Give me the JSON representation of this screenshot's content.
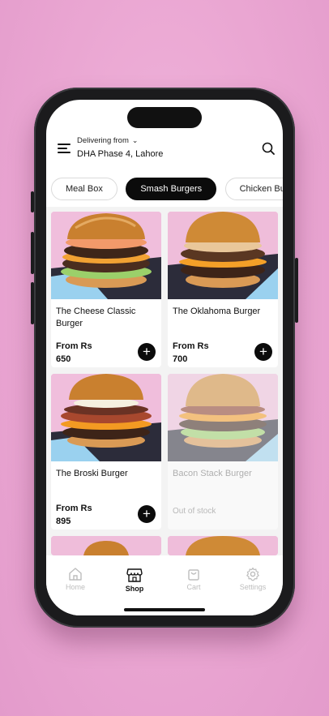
{
  "header": {
    "delivering_label": "Delivering from",
    "address": "DHA Phase 4, Lahore"
  },
  "tabs": [
    {
      "label": "Meal Box",
      "active": false
    },
    {
      "label": "Smash Burgers",
      "active": true
    },
    {
      "label": "Chicken Burg",
      "active": false
    }
  ],
  "products": [
    {
      "title": "The Cheese Classic Burger",
      "price_label": "From Rs",
      "price": "650",
      "in_stock": true
    },
    {
      "title": "The Oklahoma Burger",
      "price_label": "From Rs",
      "price": "700",
      "in_stock": true
    },
    {
      "title": "The Broski Burger",
      "price_label": "From Rs",
      "price": "895",
      "in_stock": true
    },
    {
      "title": "Bacon Stack Burger",
      "status": "Out of stock",
      "in_stock": false
    }
  ],
  "bottom_nav": [
    {
      "label": "Home",
      "icon": "home-icon",
      "active": false
    },
    {
      "label": "Shop",
      "icon": "shop-icon",
      "active": true
    },
    {
      "label": "Cart",
      "icon": "cart-icon",
      "active": false
    },
    {
      "label": "Settings",
      "icon": "gear-icon",
      "active": false
    }
  ],
  "colors": {
    "background": "#eaa6d2",
    "accent": "#0b0b0b",
    "muted_text": "#bdbdbd"
  }
}
